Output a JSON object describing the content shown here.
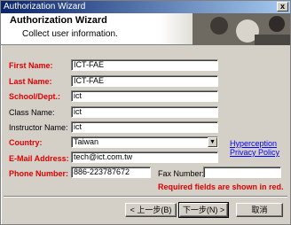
{
  "window": {
    "title": "Authorization Wizard",
    "close_label": "x"
  },
  "banner": {
    "title": "Authorization Wizard",
    "subtitle": "Collect user information."
  },
  "form": {
    "first_name": {
      "label": "First Name:",
      "value": "ICT-FAE"
    },
    "last_name": {
      "label": "Last Name:",
      "value": "ICT-FAE"
    },
    "school_dept": {
      "label": "School/Dept.:",
      "value": "ict"
    },
    "class_name": {
      "label": "Class Name:",
      "value": "ict"
    },
    "instructor_name": {
      "label": "Instructor Name:",
      "value": "ict"
    },
    "country": {
      "label": "Country:",
      "value": "Taiwan"
    },
    "email": {
      "label": "E-Mail Address:",
      "value": "tech@ict.com.tw"
    },
    "phone": {
      "label": "Phone Number:",
      "value": "886-223787672"
    },
    "fax": {
      "label": "Fax Number:",
      "value": ""
    }
  },
  "links": {
    "hyperception": "Hyperception",
    "privacy": "Privacy Policy"
  },
  "note": "Required fields are shown in red.",
  "buttons": {
    "back": "< 上一步(B)",
    "next": "下一步(N) >",
    "cancel": "取消"
  },
  "colors": {
    "required": "#e00000",
    "link": "#0000ff",
    "titlebar": "#0a246a"
  }
}
